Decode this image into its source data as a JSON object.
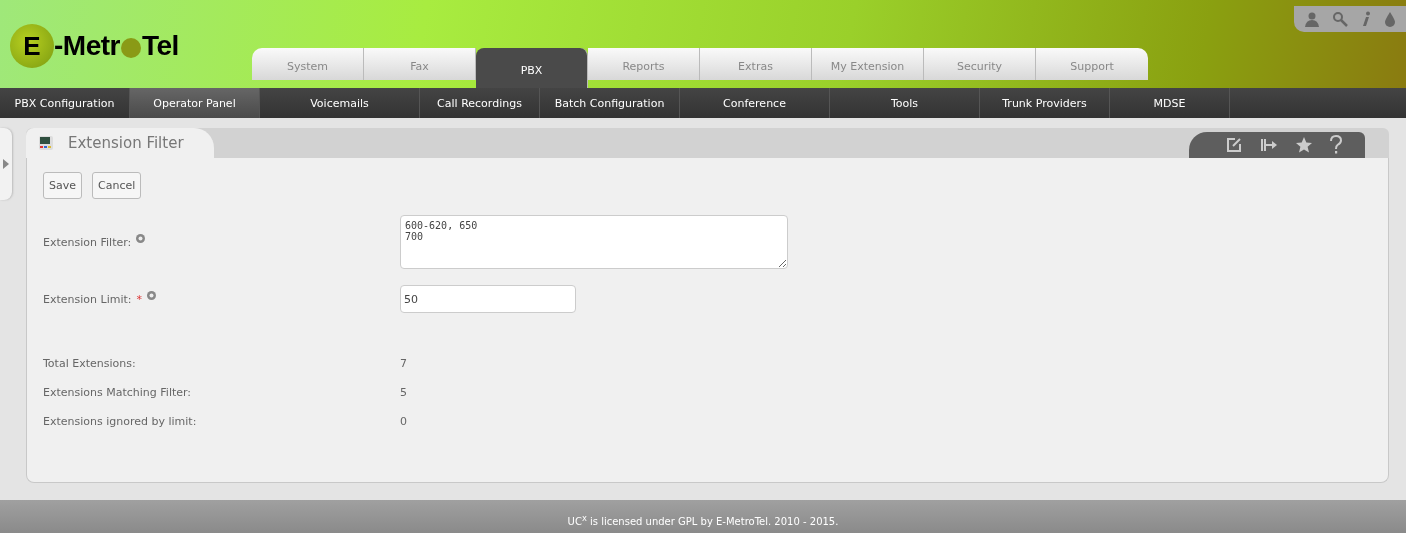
{
  "logo": {
    "initial": "E",
    "part_1": "-Metr",
    "part_2": "Tel"
  },
  "top_tabs": [
    {
      "label": "System",
      "selected": false
    },
    {
      "label": "Fax",
      "selected": false
    },
    {
      "label": "PBX",
      "selected": true
    },
    {
      "label": "Reports",
      "selected": false
    },
    {
      "label": "Extras",
      "selected": false
    },
    {
      "label": "My Extension",
      "selected": false
    },
    {
      "label": "Security",
      "selected": false
    },
    {
      "label": "Support",
      "selected": false
    }
  ],
  "sub_menu": [
    {
      "label": "PBX Configuration",
      "selected": false
    },
    {
      "label": "Operator Panel",
      "selected": true
    },
    {
      "label": "Voicemails",
      "selected": false
    },
    {
      "label": "Call Recordings",
      "selected": false
    },
    {
      "label": "Batch Configuration",
      "selected": false
    },
    {
      "label": "Conference",
      "selected": false
    },
    {
      "label": "Tools",
      "selected": false
    },
    {
      "label": "Trunk Providers",
      "selected": false
    },
    {
      "label": "MDSE",
      "selected": false
    }
  ],
  "panel": {
    "title": "Extension Filter",
    "buttons": [
      "Save",
      "Cancel"
    ],
    "fields": [
      {
        "label": "Extension Filter:",
        "required": false,
        "kind": "textarea",
        "value": "600-620, 650\n700"
      },
      {
        "label": "Extension Limit:",
        "required": true,
        "required_mark": "*",
        "kind": "input",
        "value": "50"
      }
    ],
    "stats": [
      {
        "label": "Total Extensions:",
        "value": "7"
      },
      {
        "label": "Extensions Matching Filter:",
        "value": "5"
      },
      {
        "label": "Extensions ignored by limit:",
        "value": "0"
      }
    ]
  },
  "footer": "UC$^{x}$ is licensed under GPL by E-MetroTel. 2010 - 2015."
}
